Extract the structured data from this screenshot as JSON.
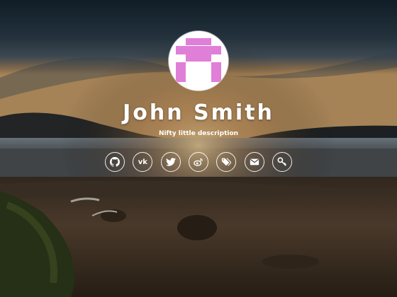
{
  "profile": {
    "name": "John Smith",
    "description": "Nifty little description",
    "avatar_color": "#e07fd8"
  },
  "social_links": [
    {
      "id": "github",
      "icon": "github-icon"
    },
    {
      "id": "vk",
      "icon": "vk-icon",
      "glyph": "vk"
    },
    {
      "id": "twitter",
      "icon": "twitter-icon"
    },
    {
      "id": "weibo",
      "icon": "weibo-icon"
    },
    {
      "id": "tags",
      "icon": "tag-icon"
    },
    {
      "id": "email",
      "icon": "envelope-icon"
    },
    {
      "id": "keybase",
      "icon": "key-icon"
    }
  ]
}
